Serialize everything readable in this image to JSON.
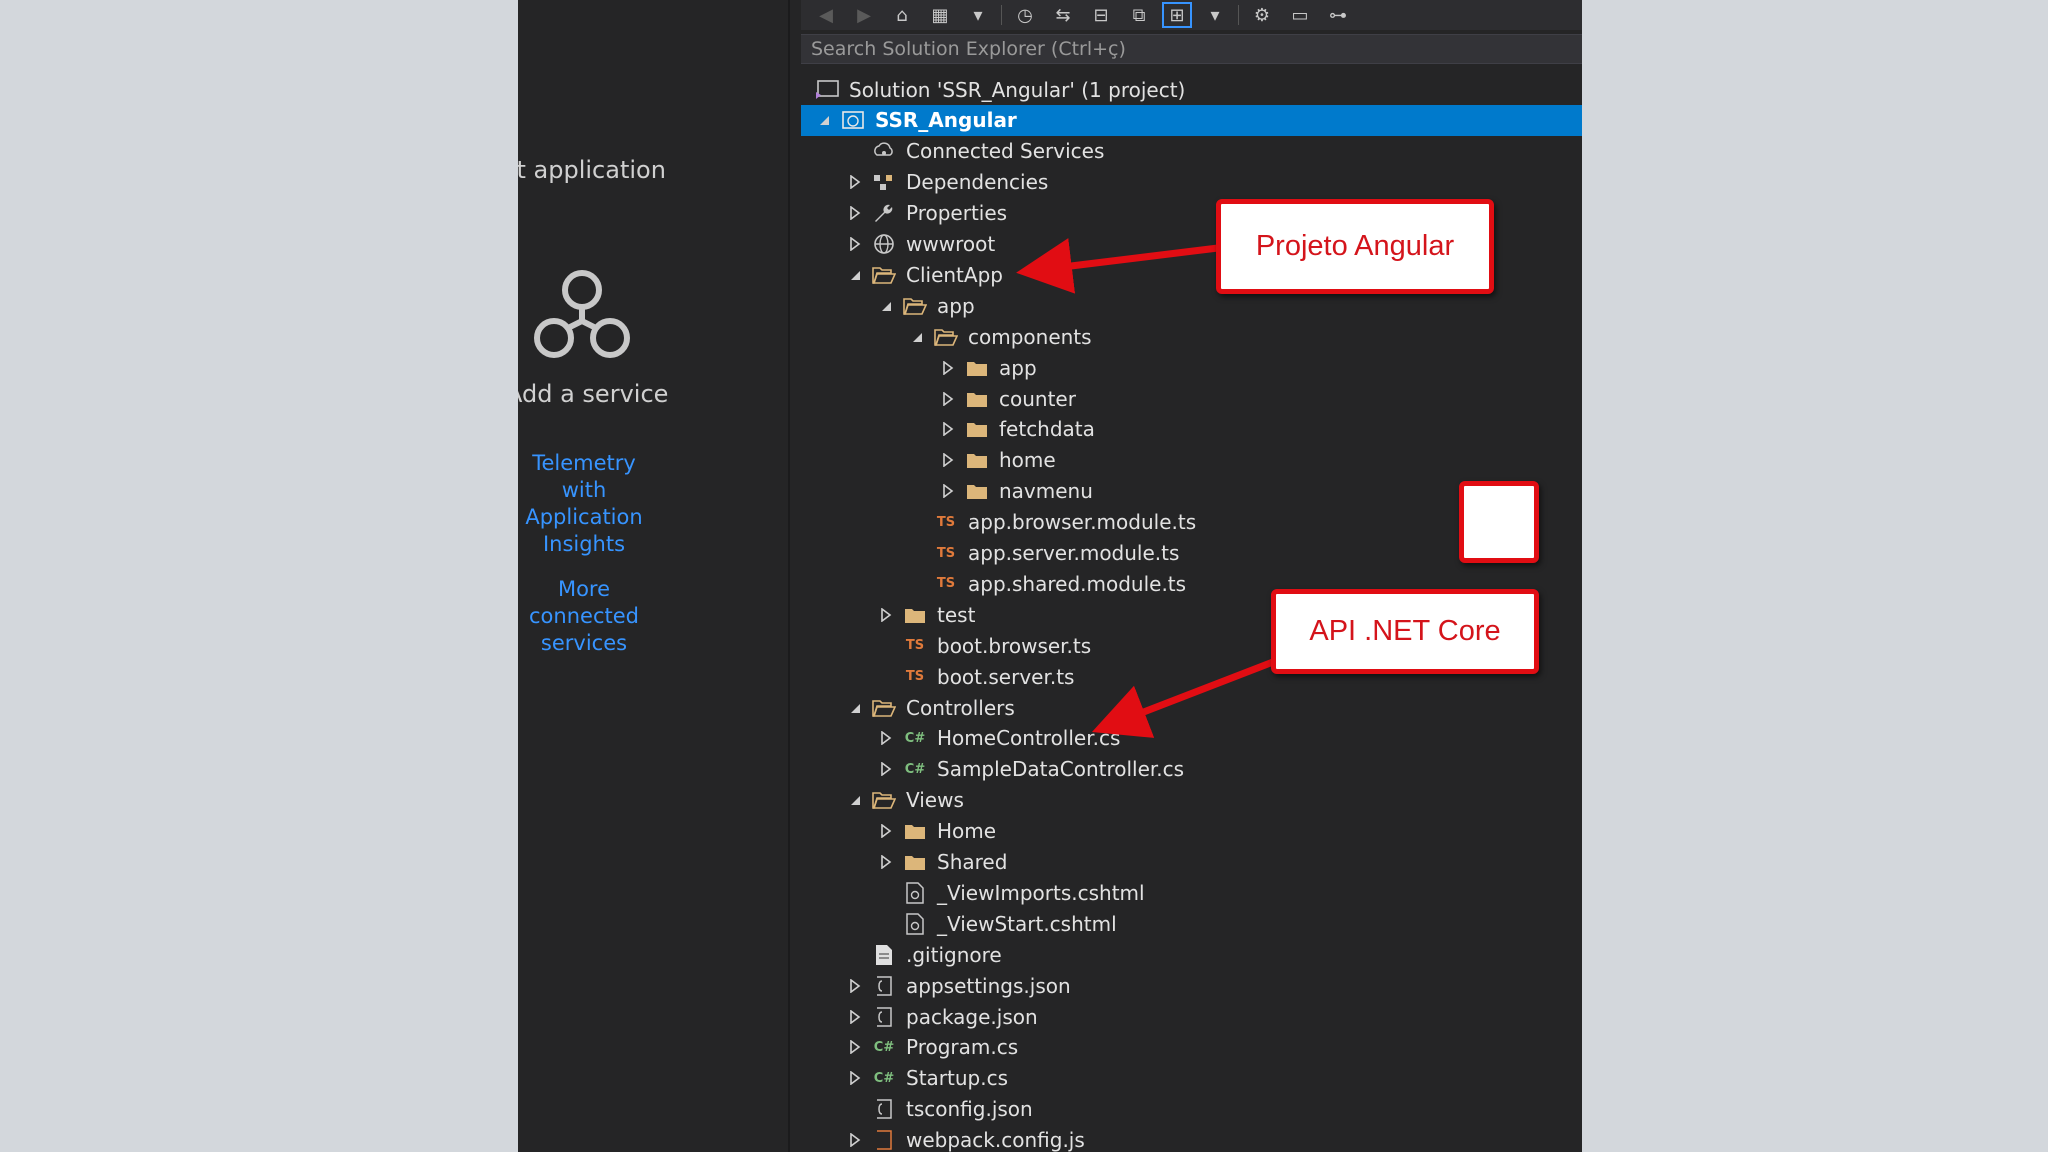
{
  "connected_services": {
    "title_partial": "st application",
    "add_service": "Add a service",
    "links": [
      "Telemetry with Application Insights",
      "More connected services"
    ]
  },
  "solution_explorer": {
    "search_placeholder": "Search Solution Explorer (Ctrl+ç)",
    "toolbar_icons": [
      "back-icon",
      "forward-icon",
      "home-icon",
      "switch-views-icon",
      "dropdown-icon",
      "history-icon",
      "sync-icon",
      "collapse-icon",
      "copy-icon",
      "show-all-files-icon",
      "dropdown-icon",
      "properties-icon",
      "preview-icon",
      "class-diagram-icon"
    ],
    "tree": [
      {
        "label": "Solution 'SSR_Angular' (1 project)",
        "depth": 0,
        "expander": "none",
        "icon": "solution-icon"
      },
      {
        "label": "SSR_Angular",
        "depth": 0,
        "expander": "open",
        "icon": "web-project-icon",
        "selected": true
      },
      {
        "label": "Connected Services",
        "depth": 1,
        "expander": "none",
        "icon": "connected-services-icon"
      },
      {
        "label": "Dependencies",
        "depth": 1,
        "expander": "closed",
        "icon": "dependencies-icon"
      },
      {
        "label": "Properties",
        "depth": 1,
        "expander": "closed",
        "icon": "wrench-icon"
      },
      {
        "label": "wwwroot",
        "depth": 1,
        "expander": "closed",
        "icon": "globe-icon"
      },
      {
        "label": "ClientApp",
        "depth": 1,
        "expander": "open",
        "icon": "folder-open-icon"
      },
      {
        "label": "app",
        "depth": 2,
        "expander": "open",
        "icon": "folder-open-icon"
      },
      {
        "label": "components",
        "depth": 3,
        "expander": "open",
        "icon": "folder-open-icon"
      },
      {
        "label": "app",
        "depth": 4,
        "expander": "closed",
        "icon": "folder-icon"
      },
      {
        "label": "counter",
        "depth": 4,
        "expander": "closed",
        "icon": "folder-icon"
      },
      {
        "label": "fetchdata",
        "depth": 4,
        "expander": "closed",
        "icon": "folder-icon"
      },
      {
        "label": "home",
        "depth": 4,
        "expander": "closed",
        "icon": "folder-icon"
      },
      {
        "label": "navmenu",
        "depth": 4,
        "expander": "closed",
        "icon": "folder-icon"
      },
      {
        "label": "app.browser.module.ts",
        "depth": 3,
        "expander": "none",
        "icon": "typescript-icon"
      },
      {
        "label": "app.server.module.ts",
        "depth": 3,
        "expander": "none",
        "icon": "typescript-icon"
      },
      {
        "label": "app.shared.module.ts",
        "depth": 3,
        "expander": "none",
        "icon": "typescript-icon"
      },
      {
        "label": "test",
        "depth": 2,
        "expander": "closed",
        "icon": "folder-icon"
      },
      {
        "label": "boot.browser.ts",
        "depth": 2,
        "expander": "none",
        "icon": "typescript-icon"
      },
      {
        "label": "boot.server.ts",
        "depth": 2,
        "expander": "none",
        "icon": "typescript-icon"
      },
      {
        "label": "Controllers",
        "depth": 1,
        "expander": "open",
        "icon": "folder-open-icon"
      },
      {
        "label": "HomeController.cs",
        "depth": 2,
        "expander": "closed",
        "icon": "csharp-icon"
      },
      {
        "label": "SampleDataController.cs",
        "depth": 2,
        "expander": "closed",
        "icon": "csharp-icon"
      },
      {
        "label": "Views",
        "depth": 1,
        "expander": "open",
        "icon": "folder-open-icon"
      },
      {
        "label": "Home",
        "depth": 2,
        "expander": "closed",
        "icon": "folder-icon"
      },
      {
        "label": "Shared",
        "depth": 2,
        "expander": "closed",
        "icon": "folder-icon"
      },
      {
        "label": "_ViewImports.cshtml",
        "depth": 2,
        "expander": "none",
        "icon": "razor-icon"
      },
      {
        "label": "_ViewStart.cshtml",
        "depth": 2,
        "expander": "none",
        "icon": "razor-icon"
      },
      {
        "label": ".gitignore",
        "depth": 1,
        "expander": "none",
        "icon": "text-file-icon"
      },
      {
        "label": "appsettings.json",
        "depth": 1,
        "expander": "closed",
        "icon": "json-icon"
      },
      {
        "label": "package.json",
        "depth": 1,
        "expander": "closed",
        "icon": "json-icon"
      },
      {
        "label": "Program.cs",
        "depth": 1,
        "expander": "closed",
        "icon": "csharp-icon"
      },
      {
        "label": "Startup.cs",
        "depth": 1,
        "expander": "closed",
        "icon": "csharp-icon"
      },
      {
        "label": "tsconfig.json",
        "depth": 1,
        "expander": "none",
        "icon": "json-icon"
      },
      {
        "label": "webpack.config.js",
        "depth": 1,
        "expander": "closed",
        "icon": "js-icon"
      }
    ]
  },
  "annotations": {
    "angular": "Projeto Angular",
    "api": "API .NET Core"
  },
  "colors": {
    "selection": "#007acc",
    "callout_red": "#e10d13",
    "folder": "#dcb67a",
    "typescript": "#e07a3b",
    "csharp": "#7fbf7f",
    "link": "#3794ff"
  }
}
